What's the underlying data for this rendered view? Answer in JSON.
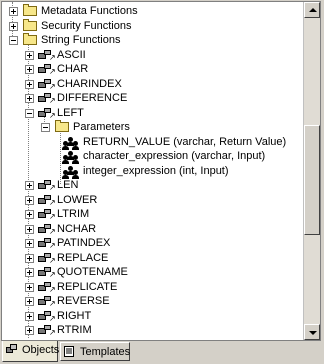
{
  "tree": {
    "items": [
      {
        "label": "Metadata Functions",
        "kind": "folder",
        "state": "closed"
      },
      {
        "label": "Security Functions",
        "kind": "folder",
        "state": "closed"
      },
      {
        "label": "String Functions",
        "kind": "folder",
        "state": "open"
      },
      {
        "label": "ASCII",
        "kind": "function",
        "state": "closed"
      },
      {
        "label": "CHAR",
        "kind": "function",
        "state": "closed"
      },
      {
        "label": "CHARINDEX",
        "kind": "function",
        "state": "closed"
      },
      {
        "label": "DIFFERENCE",
        "kind": "function",
        "state": "closed"
      },
      {
        "label": "LEFT",
        "kind": "function",
        "state": "open"
      },
      {
        "label": "Parameters",
        "kind": "folder",
        "state": "open"
      },
      {
        "label": "RETURN_VALUE (varchar, Return Value)",
        "kind": "param"
      },
      {
        "label": "character_expression (varchar, Input)",
        "kind": "param"
      },
      {
        "label": "integer_expression (int, Input)",
        "kind": "param"
      },
      {
        "label": "LEN",
        "kind": "function",
        "state": "closed"
      },
      {
        "label": "LOWER",
        "kind": "function",
        "state": "closed"
      },
      {
        "label": "LTRIM",
        "kind": "function",
        "state": "closed"
      },
      {
        "label": "NCHAR",
        "kind": "function",
        "state": "closed"
      },
      {
        "label": "PATINDEX",
        "kind": "function",
        "state": "closed"
      },
      {
        "label": "REPLACE",
        "kind": "function",
        "state": "closed"
      },
      {
        "label": "QUOTENAME",
        "kind": "function",
        "state": "closed"
      },
      {
        "label": "REPLICATE",
        "kind": "function",
        "state": "closed"
      },
      {
        "label": "REVERSE",
        "kind": "function",
        "state": "closed"
      },
      {
        "label": "RIGHT",
        "kind": "function",
        "state": "closed"
      },
      {
        "label": "RTRIM",
        "kind": "function",
        "state": "closed"
      }
    ]
  },
  "tabs": [
    {
      "label": "Objects",
      "icon": "objects-icon",
      "active": true
    },
    {
      "label": "Templates",
      "icon": "templates-icon",
      "active": false
    }
  ]
}
